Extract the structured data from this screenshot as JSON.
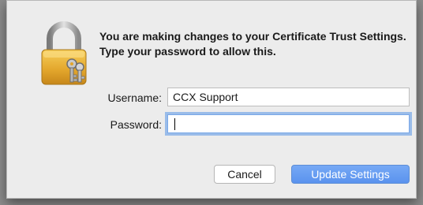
{
  "dialog": {
    "message": "You are making changes to your Certificate Trust Settings. Type your password to allow this.",
    "lock_icon": "padlock-with-keys-icon"
  },
  "form": {
    "username_label": "Username:",
    "username_value": "CCX Support",
    "password_label": "Password:",
    "password_value": ""
  },
  "buttons": {
    "cancel_label": "Cancel",
    "update_label": "Update Settings"
  },
  "colors": {
    "dialog_bg": "#ececec",
    "default_button": "#5a93ee",
    "focus_ring": "#5896e8"
  }
}
